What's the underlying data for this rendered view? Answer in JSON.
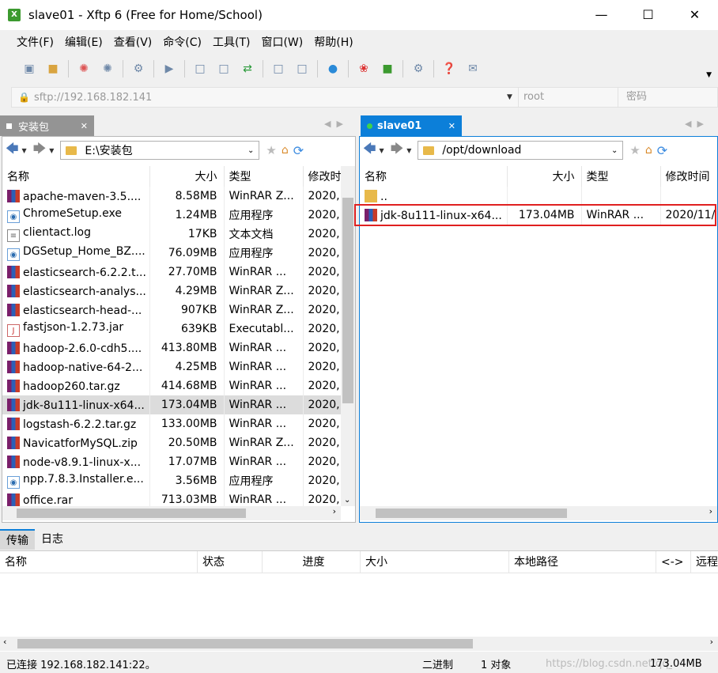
{
  "window": {
    "title": "slave01 - Xftp 6 (Free for Home/School)",
    "app_icon": "xftp-icon"
  },
  "menu": [
    "文件(F)",
    "编辑(E)",
    "查看(V)",
    "命令(C)",
    "工具(T)",
    "窗口(W)",
    "帮助(H)"
  ],
  "address": {
    "host_placeholder": "sftp://192.168.182.141",
    "user_placeholder": "root",
    "password_placeholder": "密码"
  },
  "left": {
    "tab": "安装包",
    "path": "E:\\安装包",
    "columns": [
      "名称",
      "大小",
      "类型",
      "修改时"
    ],
    "files": [
      {
        "name": "apache-maven-3.5....",
        "size": "8.58MB",
        "type": "WinRAR Z...",
        "date": "2020,",
        "icon": "rar"
      },
      {
        "name": "ChromeSetup.exe",
        "size": "1.24MB",
        "type": "应用程序",
        "date": "2020,",
        "icon": "exe"
      },
      {
        "name": "clientact.log",
        "size": "17KB",
        "type": "文本文档",
        "date": "2020,",
        "icon": "log"
      },
      {
        "name": "DGSetup_Home_BZ....",
        "size": "76.09MB",
        "type": "应用程序",
        "date": "2020,",
        "icon": "exe"
      },
      {
        "name": "elasticsearch-6.2.2.t...",
        "size": "27.70MB",
        "type": "WinRAR ...",
        "date": "2020,",
        "icon": "rar"
      },
      {
        "name": "elasticsearch-analys...",
        "size": "4.29MB",
        "type": "WinRAR Z...",
        "date": "2020,",
        "icon": "rar"
      },
      {
        "name": "elasticsearch-head-...",
        "size": "907KB",
        "type": "WinRAR Z...",
        "date": "2020,",
        "icon": "rar"
      },
      {
        "name": "fastjson-1.2.73.jar",
        "size": "639KB",
        "type": "Executabl...",
        "date": "2020,",
        "icon": "jar"
      },
      {
        "name": "hadoop-2.6.0-cdh5....",
        "size": "413.80MB",
        "type": "WinRAR ...",
        "date": "2020,",
        "icon": "rar"
      },
      {
        "name": "hadoop-native-64-2...",
        "size": "4.25MB",
        "type": "WinRAR ...",
        "date": "2020,",
        "icon": "rar"
      },
      {
        "name": "hadoop260.tar.gz",
        "size": "414.68MB",
        "type": "WinRAR ...",
        "date": "2020,",
        "icon": "rar"
      },
      {
        "name": "jdk-8u111-linux-x64...",
        "size": "173.04MB",
        "type": "WinRAR ...",
        "date": "2020,",
        "icon": "rar",
        "selected": true
      },
      {
        "name": "logstash-6.2.2.tar.gz",
        "size": "133.00MB",
        "type": "WinRAR ...",
        "date": "2020,",
        "icon": "rar"
      },
      {
        "name": "NavicatforMySQL.zip",
        "size": "20.50MB",
        "type": "WinRAR Z...",
        "date": "2020,",
        "icon": "rar"
      },
      {
        "name": "node-v8.9.1-linux-x...",
        "size": "17.07MB",
        "type": "WinRAR ...",
        "date": "2020,",
        "icon": "rar"
      },
      {
        "name": "npp.7.8.3.Installer.e...",
        "size": "3.56MB",
        "type": "应用程序",
        "date": "2020,",
        "icon": "exe"
      },
      {
        "name": "office.rar",
        "size": "713.03MB",
        "type": "WinRAR ...",
        "date": "2020,",
        "icon": "rar"
      }
    ]
  },
  "right": {
    "tab": "slave01",
    "path": "/opt/download",
    "columns": [
      "名称",
      "大小",
      "类型",
      "修改时间"
    ],
    "files": [
      {
        "name": "..",
        "size": "",
        "type": "",
        "date": "",
        "icon": "folder"
      },
      {
        "name": "jdk-8u111-linux-x64...",
        "size": "173.04MB",
        "type": "WinRAR ...",
        "date": "2020/11/",
        "icon": "rar"
      }
    ]
  },
  "bottom": {
    "tabs": [
      "传输",
      "日志"
    ],
    "columns": [
      "名称",
      "状态",
      "进度",
      "大小",
      "本地路径",
      "<->",
      "远程"
    ]
  },
  "status": {
    "connection": "已连接 192.168.182.141:22。",
    "mode": "二进制",
    "objects": "1 对象",
    "size": "173.04MB",
    "watermark": "https://blog.csdn.net/qq_42..."
  },
  "colors": {
    "accent": "#0c7fd9",
    "highlight_box": "#e02020"
  }
}
